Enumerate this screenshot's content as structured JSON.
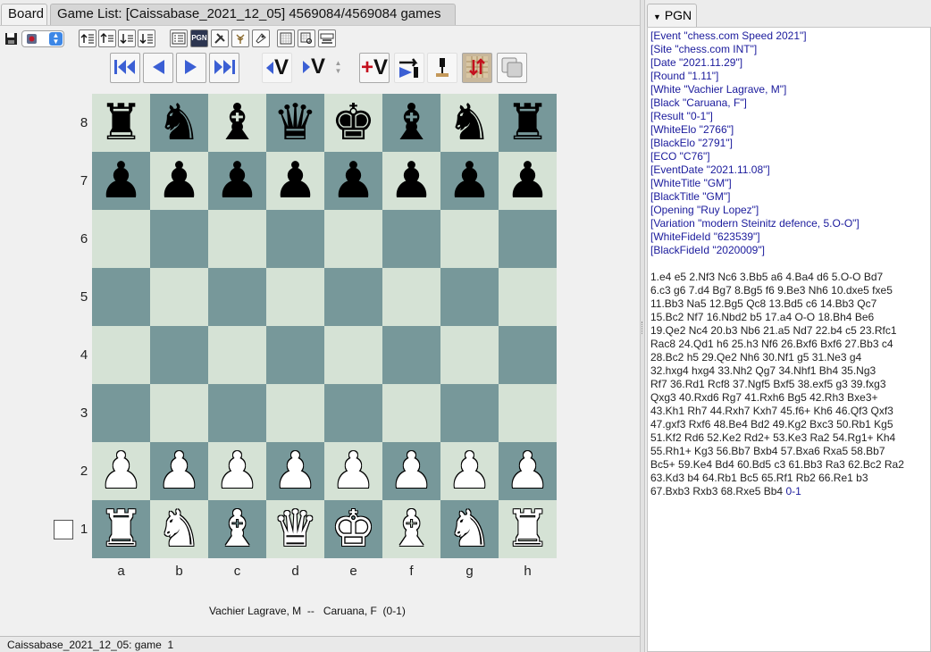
{
  "tabs": {
    "board": "Board",
    "game_list": "Game List: [Caissabase_2021_12_05] 4569084/4569084 games"
  },
  "toolbar": {
    "pgn_icon_text": "PGN",
    "var_label": "V",
    "add_var_label": "+V"
  },
  "board": {
    "ranks": [
      "8",
      "7",
      "6",
      "5",
      "4",
      "3",
      "2",
      "1"
    ],
    "files": [
      "a",
      "b",
      "c",
      "d",
      "e",
      "f",
      "g",
      "h"
    ],
    "position": [
      [
        "r",
        "n",
        "b",
        "q",
        "k",
        "b",
        "n",
        "r"
      ],
      [
        "p",
        "p",
        "p",
        "p",
        "p",
        "p",
        "p",
        "p"
      ],
      [
        "",
        "",
        "",
        "",
        "",
        "",
        "",
        ""
      ],
      [
        "",
        "",
        "",
        "",
        "",
        "",
        "",
        ""
      ],
      [
        "",
        "",
        "",
        "",
        "",
        "",
        "",
        ""
      ],
      [
        "",
        "",
        "",
        "",
        "",
        "",
        "",
        ""
      ],
      [
        "P",
        "P",
        "P",
        "P",
        "P",
        "P",
        "P",
        "P"
      ],
      [
        "R",
        "N",
        "B",
        "Q",
        "K",
        "B",
        "N",
        "R"
      ]
    ],
    "light_color": "#d5e2d5",
    "dark_color": "#77989a"
  },
  "players": {
    "line": "Vachier Lagrave, M  --   Caruana, F  (0-1)"
  },
  "status": {
    "text": "Caissabase_2021_12_05: game  1"
  },
  "pgn": {
    "tab_label": "PGN",
    "tags": [
      "[Event \"chess.com Speed 2021\"]",
      "[Site \"chess.com INT\"]",
      "[Date \"2021.11.29\"]",
      "[Round \"1.11\"]",
      "[White \"Vachier Lagrave, M\"]",
      "[Black \"Caruana, F\"]",
      "[Result \"0-1\"]",
      "[WhiteElo \"2766\"]",
      "[BlackElo \"2791\"]",
      "[ECO \"C76\"]",
      "[EventDate \"2021.11.08\"]",
      "[WhiteTitle \"GM\"]",
      "[BlackTitle \"GM\"]",
      "[Opening \"Ruy Lopez\"]",
      "[Variation \"modern Steinitz defence, 5.O-O\"]",
      "[WhiteFideId \"623539\"]",
      "[BlackFideId \"2020009\"]"
    ],
    "move_lines": [
      "1.e4 e5 2.Nf3 Nc6 3.Bb5 a6 4.Ba4 d6 5.O-O Bd7",
      "6.c3 g6 7.d4 Bg7 8.Bg5 f6 9.Be3 Nh6 10.dxe5 fxe5",
      "11.Bb3 Na5 12.Bg5 Qc8 13.Bd5 c6 14.Bb3 Qc7",
      "15.Bc2 Nf7 16.Nbd2 b5 17.a4 O-O 18.Bh4 Be6",
      "19.Qe2 Nc4 20.b3 Nb6 21.a5 Nd7 22.b4 c5 23.Rfc1",
      "Rac8 24.Qd1 h6 25.h3 Nf6 26.Bxf6 Bxf6 27.Bb3 c4",
      "28.Bc2 h5 29.Qe2 Nh6 30.Nf1 g5 31.Ne3 g4",
      "32.hxg4 hxg4 33.Nh2 Qg7 34.Nhf1 Bh4 35.Ng3",
      "Rf7 36.Rd1 Rcf8 37.Ngf5 Bxf5 38.exf5 g3 39.fxg3",
      "Qxg3 40.Rxd6 Rg7 41.Rxh6 Bg5 42.Rh3 Bxe3+",
      "43.Kh1 Rh7 44.Rxh7 Kxh7 45.f6+ Kh6 46.Qf3 Qxf3",
      "47.gxf3 Rxf6 48.Be4 Bd2 49.Kg2 Bxc3 50.Rb1 Kg5",
      "51.Kf2 Rd6 52.Ke2 Rd2+ 53.Ke3 Ra2 54.Rg1+ Kh4",
      "55.Rh1+ Kg3 56.Bb7 Bxb4 57.Bxa6 Rxa5 58.Bb7",
      "Bc5+ 59.Ke4 Bd4 60.Bd5 c3 61.Bb3 Ra3 62.Bc2 Ra2",
      "63.Kd3 b4 64.Rb1 Bc5 65.Rf1 Rb2 66.Re1 b3"
    ],
    "last_line_moves": "67.Bxb3 Rxb3 68.Rxe5 Bb4",
    "result": "0-1"
  }
}
